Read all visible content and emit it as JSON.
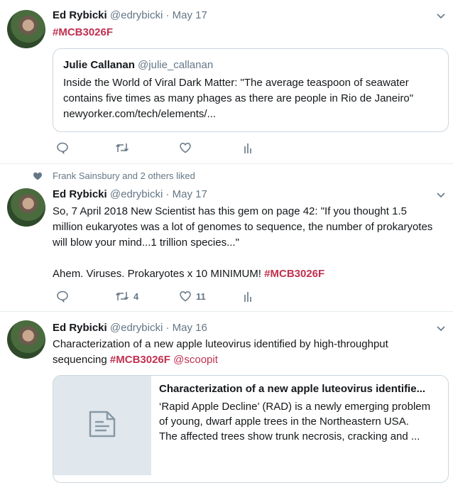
{
  "tweets": [
    {
      "name": "Ed Rybicki",
      "handle": "@edrybicki",
      "sep": "·",
      "date": "May 17",
      "hashtag": "#MCB3026F",
      "quote": {
        "name": "Julie Callanan",
        "handle": "@julie_callanan",
        "line1": "Inside the World of Viral Dark Matter: \"The average teaspoon of seawater",
        "line2": "contains five times as many phages as there are people in Rio de Janeiro\"",
        "line3": "newyorker.com/tech/elements/..."
      }
    },
    {
      "social_context": "Frank Sainsbury and 2 others liked",
      "name": "Ed Rybicki",
      "handle": "@edrybicki",
      "sep": "·",
      "date": "May 17",
      "line1": "So, 7 April 2018 New Scientist has this gem on page 42: \"If you thought 1.5",
      "line2": "million eukaryotes was a lot of genomes to sequence, the number of prokaryotes",
      "line3": "will blow your mind...1 trillion species...\"",
      "line4_text": "Ahem. Viruses. Prokaryotes x 10 MINIMUM!",
      "hashtag": "#MCB3026F",
      "retweets": "4",
      "likes": "11"
    },
    {
      "name": "Ed Rybicki",
      "handle": "@edrybicki",
      "sep": "·",
      "date": "May 16",
      "line1": "Characterization of a new apple luteovirus identified by high-throughput",
      "line2_text": "sequencing",
      "hashtag": "#MCB3026F",
      "mention": "@scoopit",
      "card": {
        "title": "Characterization of a new apple luteovirus identifie...",
        "desc1": "‘Rapid Apple Decline’ (RAD) is a newly emerging problem",
        "desc2": "of young, dwarf apple trees in the Northeastern USA.",
        "desc3": "The affected trees show trunk necrosis, cracking and ..."
      }
    }
  ],
  "icons": {
    "reply": "reply-icon",
    "retweet": "retweet-icon",
    "like": "heart-icon",
    "analytics": "analytics-icon",
    "caret": "chevron-down-icon",
    "article": "document-icon"
  },
  "colors": {
    "hashtag": "#c0304f",
    "muted": "#657786",
    "border": "#e6ecf0"
  }
}
